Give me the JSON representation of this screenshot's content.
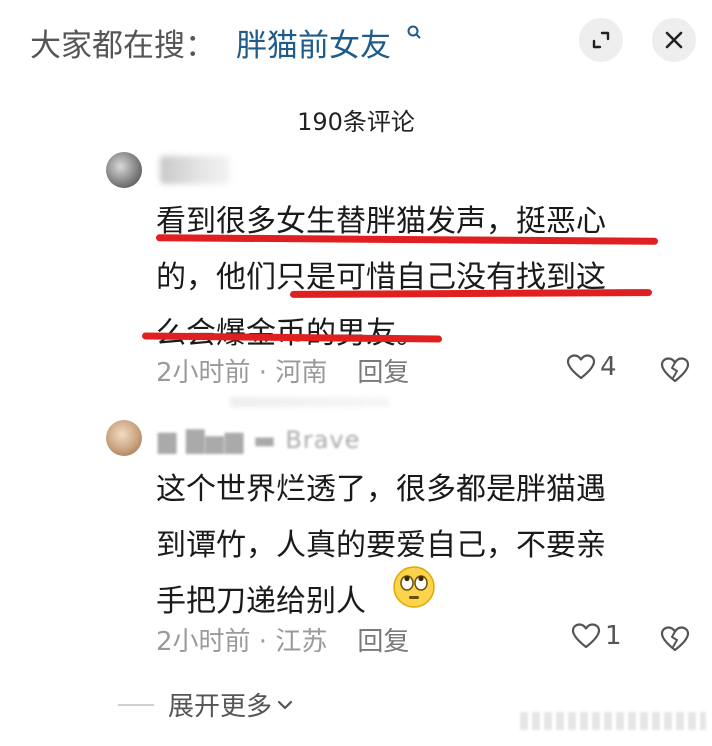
{
  "header": {
    "prefix": "大家都在搜：",
    "keyword": "胖猫前女友",
    "buttons": {
      "expand_icon": "expand-icon",
      "close_icon": "close-icon"
    }
  },
  "comments_count": "190条评论",
  "comments": [
    {
      "lines": [
        "看到很多女生替胖猫发声，挺恶心",
        "的，他们只是可惜自己没有找到这",
        "么会爆金币的男友。"
      ],
      "time": "2小时前",
      "location": "河南",
      "reply": "回复",
      "likes": "4"
    },
    {
      "username": "Brave",
      "lines": [
        "这个世界烂透了，很多都是胖猫遇",
        "到谭竹，人真的要爱自己，不要亲",
        "手把刀递给别人"
      ],
      "time": "2小时前",
      "location": "江苏",
      "reply": "回复",
      "likes": "1"
    }
  ],
  "expand_more": "展开更多",
  "colors": {
    "keyword": "#1f5c8a",
    "underline": "#e02020",
    "meta": "#9a9a9a"
  }
}
